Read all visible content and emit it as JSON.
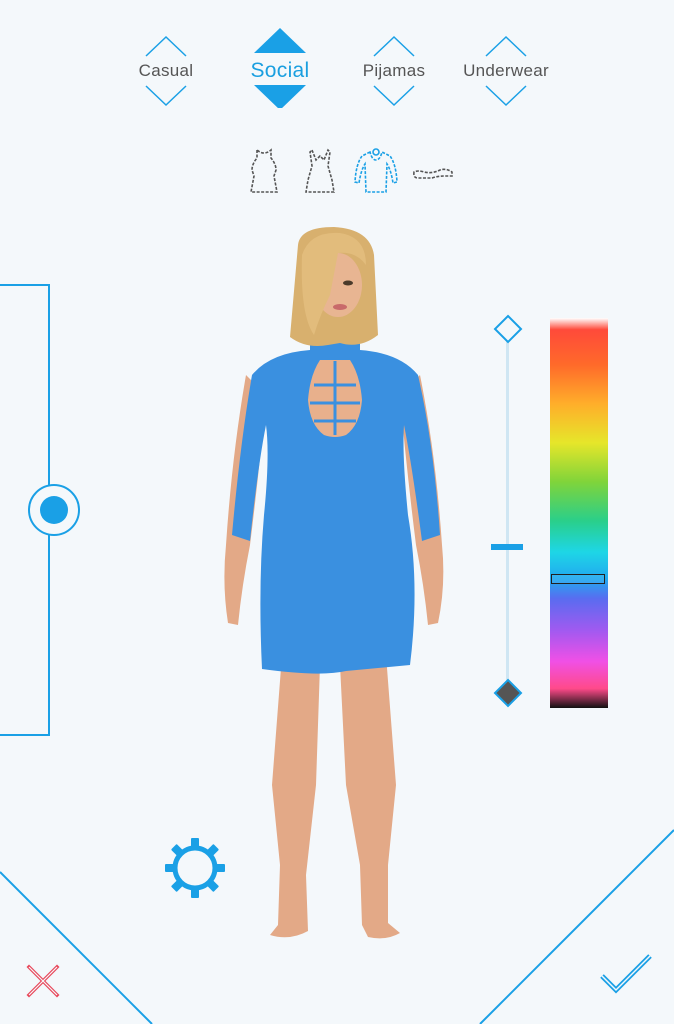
{
  "categories": [
    {
      "label": "Casual",
      "active": false
    },
    {
      "label": "Social",
      "active": true
    },
    {
      "label": "Pijamas",
      "active": false
    },
    {
      "label": "Underwear",
      "active": false
    }
  ],
  "garment_icons": [
    "tank-top-icon",
    "dress-icon",
    "long-sleeve-dress-icon",
    "shoe-icon"
  ],
  "selected_garment": "long-sleeve-dress-icon",
  "colors": {
    "accent": "#1aa0e6",
    "dress": "#3a90e0",
    "cancel": "#e8475a",
    "background": "#f4f8fb"
  },
  "color_picker": {
    "brightness_level": 0.4,
    "hue_level": 0.67
  },
  "actions": {
    "settings": "gear-icon",
    "cancel": "close-icon",
    "confirm": "checkmark-icon"
  }
}
